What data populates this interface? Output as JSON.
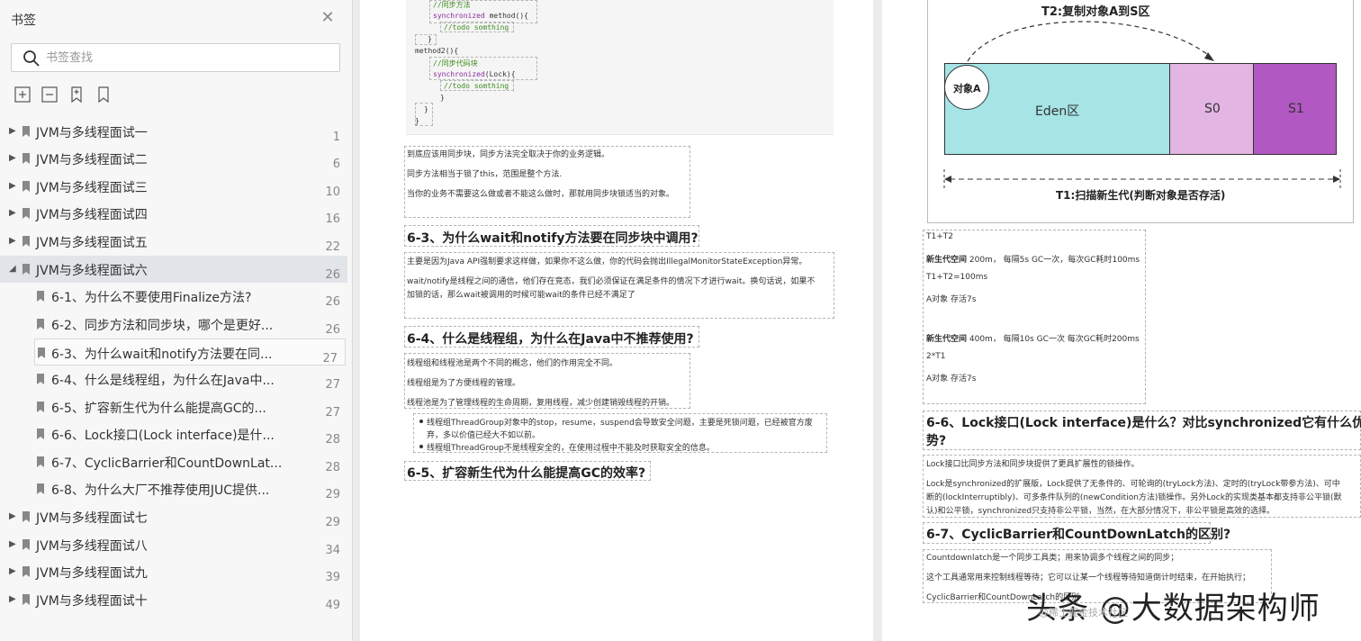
{
  "sidebar": {
    "title": "书签",
    "search_placeholder": "书签查找",
    "items": [
      {
        "label": "JVM与多线程面试一",
        "page": "1"
      },
      {
        "label": "JVM与多线程面试二",
        "page": "6"
      },
      {
        "label": "JVM与多线程面试三",
        "page": "10"
      },
      {
        "label": "JVM与多线程面试四",
        "page": "16"
      },
      {
        "label": "JVM与多线程面试五",
        "page": "22"
      },
      {
        "label": "JVM与多线程面试六",
        "page": "26"
      },
      {
        "label": "6-1、为什么不要使用Finalize方法?",
        "page": "26"
      },
      {
        "label": "6-2、同步方法和同步块，哪个是更好...",
        "page": "26"
      },
      {
        "label": "6-3、为什么wait和notify方法要在同...",
        "page": "27"
      },
      {
        "label": "6-4、什么是线程组，为什么在Java中...",
        "page": "27"
      },
      {
        "label": "6-5、扩容新生代为什么能提高GC的...",
        "page": "27"
      },
      {
        "label": "6-6、Lock接口(Lock interface)是什...",
        "page": "28"
      },
      {
        "label": "6-7、CyclicBarrier和CountDownLat...",
        "page": "28"
      },
      {
        "label": "6-8、为什么大厂不推荐使用JUC提供...",
        "page": "29"
      },
      {
        "label": "JVM与多线程面试七",
        "page": "29"
      },
      {
        "label": "JVM与多线程面试八",
        "page": "34"
      },
      {
        "label": "JVM与多线程面试九",
        "page": "39"
      },
      {
        "label": "JVM与多线程面试十",
        "page": "49"
      }
    ]
  },
  "pageA": {
    "code": {
      "l1": "//同步方法",
      "l2a": "synchronized",
      "l2b": " method(){",
      "l3": "//todo somthing",
      "l4": "}",
      "l5": "method2(){",
      "l6": "//同步代码块",
      "l7a": "synchronized",
      "l7b": "(Lock){",
      "l8": "//todo somthing",
      "l9": "}",
      "l10": "}",
      "l11": "}"
    },
    "p1": "到底应该用同步块，同步方法完全取决于你的业务逻辑。",
    "p2": "同步方法相当于锁了this，范围是整个方法.",
    "p3": "当你的业务不需要这么做或者不能这么做时，那就用同步块锁适当的对象。",
    "h63": "6-3、为什么wait和notify方法要在同步块中调用?",
    "p4": "主要是因为Java API强制要求这样做，如果你不这么做，你的代码会抛出IllegalMonitorStateException异常。",
    "p5": "wait/notify是线程之间的通信，他们存在竞态，我们必须保证在满足条件的情况下才进行wait。换句话说，如果不",
    "p6": "加锁的话，那么wait被调用的时候可能wait的条件已经不满足了",
    "h64": "6-4、什么是线程组，为什么在Java中不推荐使用?",
    "p7": "线程组和线程池是两个不同的概念，他们的作用完全不同。",
    "p8": "线程组是为了方便线程的管理。",
    "p9": "线程池是为了管理线程的生命周期，复用线程，减少创建销毁线程的开销。",
    "b1": "线程组ThreadGroup对象中的stop，resume，suspend会导致安全问题，主要是死锁问题，已经被官方废",
    "b1b": "弃，多以价值已经大不如以前。",
    "b2": "线程组ThreadGroup不是线程安全的，在使用过程中不能及时获取安全的信息。",
    "h65": "6-5、扩容新生代为什么能提高GC的效率?"
  },
  "pageB": {
    "diagram": {
      "t2": "T2:复制对象A到S区",
      "objA": "对象A",
      "eden": "Eden区",
      "s0": "S0",
      "s1": "S1",
      "t1": "T1:扫描新生代(判断对象是否存活)",
      "eden_color": "#a6e4e6",
      "s0_color": "#e2b5e2",
      "s1_color": "#b258c2"
    },
    "q1": "T1+T2",
    "q2a": "新生代空间",
    "q2b": " 200m，  每隔5s GC一次，每次GC耗时100ms",
    "q3": "T1+T2=100ms",
    "q4": "A对象 存活7s",
    "q5a": "新生代空间",
    "q5b": " 400m，  每隔10s GC一次 每次GC耗时200ms",
    "q6": "2*T1",
    "q7": "A对象 存活7s",
    "h66a": "6-6、Lock接口(Lock interface)是什么？对比synchronized它有什么优",
    "h66b": "势?",
    "r1": "Lock接口比同步方法和同步块提供了更具扩展性的锁操作。",
    "r2": "Lock是synchronized的扩展版，Lock提供了无条件的、可轮询的(tryLock方法)、定时的(tryLock带参方法)、可中",
    "r3": "断的(lockInterruptibly)、可多条件队列的(newCondition方法)锁操作。另外Lock的实现类基本都支持非公平锁(默",
    "r4": "认)和公平锁，synchronized只支持非公平锁，当然，在大部分情况下，非公平锁是高效的选择。",
    "h67": "6-7、CyclicBarrier和CountDownLatch的区别?",
    "r5": "Countdownlatch是一个同步工具类；用来协调多个线程之间的同步；",
    "r6": "这个工具通常用来控制线程等待；它可以让某一个线程等待知道倒计时结束，在开始执行；",
    "r7": "CyclicBarrier和CountDownLatch的区别"
  },
  "watermark": {
    "main": "头条 @大数据架构师",
    "sub": "@稀土掘金技术社区"
  }
}
